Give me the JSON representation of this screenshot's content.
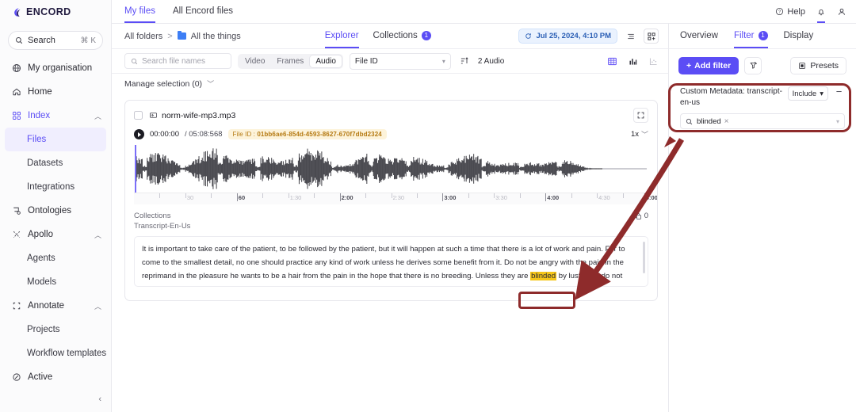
{
  "app": {
    "brand": "ENCORD"
  },
  "sidebar": {
    "search": {
      "label": "Search",
      "shortcut": "⌘ K",
      "icon": "search-icon"
    },
    "items": [
      {
        "label": "My organisation",
        "icon": "globe-icon",
        "level": "top"
      },
      {
        "label": "Home",
        "icon": "home-icon",
        "level": "top"
      },
      {
        "label": "Index",
        "icon": "grid-icon",
        "level": "top",
        "expanded": true,
        "active": true
      },
      {
        "label": "Files",
        "level": "sub",
        "current": true
      },
      {
        "label": "Datasets",
        "level": "sub"
      },
      {
        "label": "Integrations",
        "level": "sub"
      },
      {
        "label": "Ontologies",
        "icon": "ontology-icon",
        "level": "top"
      },
      {
        "label": "Apollo",
        "icon": "apollo-icon",
        "level": "top",
        "expanded": true
      },
      {
        "label": "Agents",
        "level": "sub"
      },
      {
        "label": "Models",
        "level": "sub"
      },
      {
        "label": "Annotate",
        "icon": "annotate-icon",
        "level": "top",
        "expanded": true
      },
      {
        "label": "Projects",
        "level": "sub"
      },
      {
        "label": "Workflow templates",
        "level": "sub"
      },
      {
        "label": "Active",
        "icon": "active-icon",
        "level": "top"
      }
    ],
    "collapse_icon": "chevron-left-icon"
  },
  "header": {
    "tabs": [
      {
        "label": "My files",
        "selected": true
      },
      {
        "label": "All Encord files",
        "selected": false
      }
    ],
    "help_label": "Help",
    "help_icon": "question-circle-icon",
    "bell_icon": "bell-icon",
    "user_icon": "user-icon"
  },
  "breadcrumb": {
    "root": "All folders",
    "separator": ">",
    "folder_icon": "folder-icon",
    "current": "All the things"
  },
  "view_tabs": [
    {
      "label": "Explorer",
      "selected": true,
      "badge": ""
    },
    {
      "label": "Collections",
      "selected": false,
      "badge": "1"
    }
  ],
  "toolbar_right": {
    "refresh_icon": "refresh-icon",
    "date_label": "Jul 25, 2024, 4:10 PM",
    "list_view_icon": "list-view-icon",
    "grid_view_icon": "grid-add-icon"
  },
  "filterbar": {
    "search_placeholder": "Search file names",
    "search_icon": "search-icon",
    "types": [
      {
        "label": "Video",
        "selected": false
      },
      {
        "label": "Frames",
        "selected": false
      },
      {
        "label": "Audio",
        "selected": true
      }
    ],
    "sort_field": "File ID",
    "sort_icon": "sort-icon",
    "count_label": "2 Audio",
    "view_icons": [
      {
        "name": "grid-view-icon",
        "active": true
      },
      {
        "name": "bar-chart-icon",
        "active": false
      },
      {
        "name": "scatter-plot-icon",
        "active": false
      }
    ]
  },
  "manage_selection": {
    "label": "Manage selection (0)",
    "chevron": "chevron-down-icon"
  },
  "file_card": {
    "checkbox": "file-checkbox",
    "audio_icon": "audio-file-icon",
    "filename": "norm-wife-mp3.mp3",
    "expand_icon": "expand-icon",
    "play_icon": "play-icon",
    "current_time": "00:00:00",
    "duration": "/ 05:08:568",
    "file_id_key": "File ID :",
    "file_id_value": "01bb6ae6-854d-4593-8627-670f7dbd2324",
    "playback_rate": "1x",
    "rate_chevron": "chevron-down-icon",
    "timeline_ticks": [
      {
        "label": "30",
        "major": false,
        "pos": 10.0
      },
      {
        "label": "60",
        "major": true,
        "pos": 20.0
      },
      {
        "label": "1:30",
        "major": false,
        "pos": 30.0
      },
      {
        "label": "2:00",
        "major": true,
        "pos": 40.0
      },
      {
        "label": "2:30",
        "major": false,
        "pos": 50.0
      },
      {
        "label": "3:00",
        "major": true,
        "pos": 60.0
      },
      {
        "label": "3:30",
        "major": false,
        "pos": 70.0
      },
      {
        "label": "4:00",
        "major": true,
        "pos": 80.0
      },
      {
        "label": "4:30",
        "major": false,
        "pos": 90.0
      },
      {
        "label": "5:00",
        "major": true,
        "pos": 99.2
      }
    ],
    "collections_label": "Collections",
    "transcript_label": "Transcript-En-Us",
    "copy_icon": "copy-icon",
    "copy_count": "0",
    "transcript_before": "It is important to take care of the patient, to be followed by the patient, but it will happen at such a time that there is a lot of work and pain. For to come to the smallest detail, no one should practice any kind of work unless he derives some benefit from it. Do not be angry with the pain in the reprimand in the pleasure he wants to be a hair from the pain in the hope that there is no breeding. Unless they are ",
    "transcript_highlight": "blinded",
    "transcript_after": " by lust, they do not come forth; they are in fault who abandon their duties and soften their hearts, that is, their labors."
  },
  "right_panel": {
    "tabs": [
      {
        "label": "Overview",
        "selected": false,
        "badge": ""
      },
      {
        "label": "Filter",
        "selected": true,
        "badge": "1"
      },
      {
        "label": "Display",
        "selected": false,
        "badge": ""
      }
    ],
    "add_filter_label": "Add filter",
    "add_filter_icon": "plus-icon",
    "clear_filter_icon": "clear-filter-icon",
    "presets_label": "Presets",
    "presets_icon": "presets-icon",
    "filter_card": {
      "title": "Custom Metadata: transcript-en-us",
      "mode": "Include",
      "mode_chevron": "chevron-down-icon",
      "remove_icon": "minus-icon",
      "value_icon": "search-icon",
      "value": "blinded",
      "value_clear": "×",
      "chevron": "chevron-down-icon"
    }
  },
  "annotations": {
    "color": "#8e2b2b",
    "highlight_box_filter": "filter-card-callout",
    "highlight_box_word": "blinded-word-callout",
    "arrow": "callout-arrow"
  },
  "colors": {
    "accent": "#5b4df5",
    "annotation_red": "#8e2b2b",
    "highlight_yellow": "#f5c518",
    "file_id_bg": "#fdf3da",
    "file_id_text": "#b57a12",
    "date_chip_text": "#2b5fb5"
  }
}
